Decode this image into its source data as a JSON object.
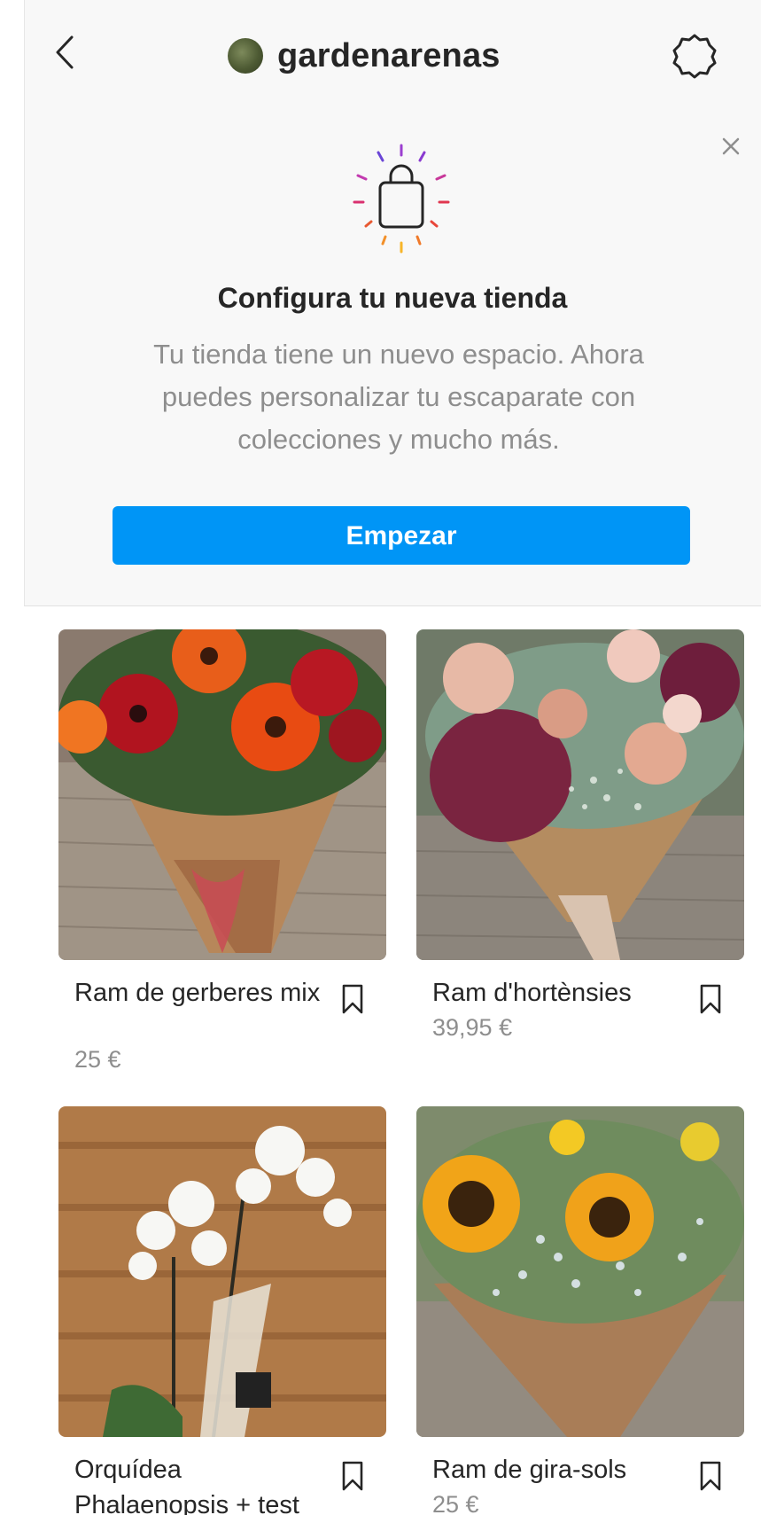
{
  "header": {
    "username": "gardenarenas",
    "back_icon": "chevron-left-icon",
    "settings_icon": "settings-icon"
  },
  "promo": {
    "icon": "shopping-bag-icon",
    "title": "Configura tu nueva tienda",
    "description": "Tu tienda tiene un nuevo espacio. Ahora puedes personalizar tu escaparate con colecciones y mucho más.",
    "button_label": "Empezar",
    "button_color": "#0095f6"
  },
  "products": [
    {
      "name": "Ram de gerberes mix",
      "price": "25 €"
    },
    {
      "name": "Ram d'hortènsies",
      "price": "39,95 €"
    },
    {
      "name": "Orquídea Phalaenopsis + test",
      "price": ""
    },
    {
      "name": "Ram de gira-sols",
      "price": "25 €"
    }
  ]
}
